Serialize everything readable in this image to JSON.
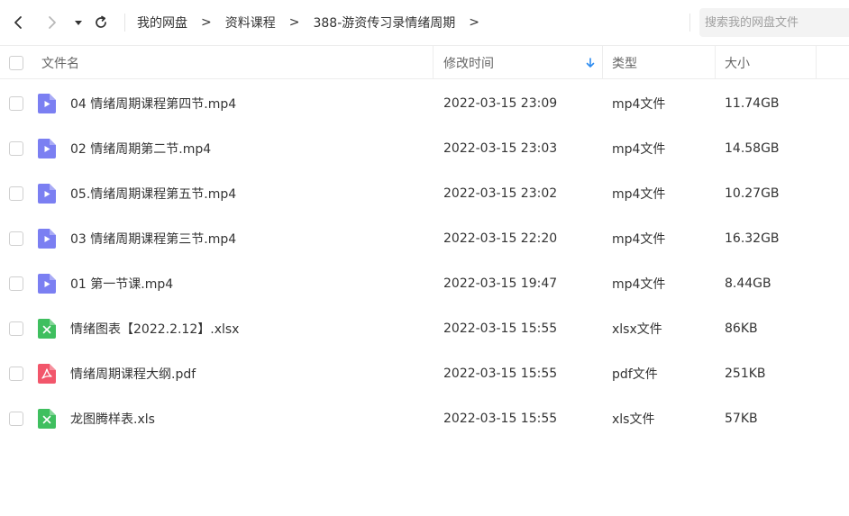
{
  "toolbar": {
    "back_icon": "chevron-left-icon",
    "forward_icon": "chevron-right-icon",
    "history_icon": "caret-down-icon",
    "refresh_icon": "refresh-icon"
  },
  "breadcrumb": {
    "items": [
      "我的网盘",
      "资料课程",
      "388-游资传习录情绪周期"
    ],
    "separator": ">"
  },
  "search": {
    "placeholder": "搜索我的网盘文件"
  },
  "table": {
    "columns": {
      "name": "文件名",
      "modified": "修改时间",
      "type": "类型",
      "size": "大小"
    },
    "sort_indicator": "sort-desc-arrow-icon",
    "rows": [
      {
        "name": "04 情绪周期课程第四节.mp4",
        "modified": "2022-03-15 23:09",
        "type": "mp4文件",
        "size": "11.74GB",
        "icon": "video-file-icon"
      },
      {
        "name": "02 情绪周期第二节.mp4",
        "modified": "2022-03-15 23:03",
        "type": "mp4文件",
        "size": "14.58GB",
        "icon": "video-file-icon"
      },
      {
        "name": "05.情绪周期课程第五节.mp4",
        "modified": "2022-03-15 23:02",
        "type": "mp4文件",
        "size": "10.27GB",
        "icon": "video-file-icon"
      },
      {
        "name": "03 情绪周期课程第三节.mp4",
        "modified": "2022-03-15 22:20",
        "type": "mp4文件",
        "size": "16.32GB",
        "icon": "video-file-icon"
      },
      {
        "name": "01 第一节课.mp4",
        "modified": "2022-03-15 19:47",
        "type": "mp4文件",
        "size": "8.44GB",
        "icon": "video-file-icon"
      },
      {
        "name": "情绪图表【2022.2.12】.xlsx",
        "modified": "2022-03-15 15:55",
        "type": "xlsx文件",
        "size": "86KB",
        "icon": "excel-file-icon"
      },
      {
        "name": "情绪周期课程大纲.pdf",
        "modified": "2022-03-15 15:55",
        "type": "pdf文件",
        "size": "251KB",
        "icon": "pdf-file-icon"
      },
      {
        "name": "龙图腾样表.xls",
        "modified": "2022-03-15 15:55",
        "type": "xls文件",
        "size": "57KB",
        "icon": "excel-file-icon"
      }
    ]
  },
  "colors": {
    "video_icon": "#7b7ff2",
    "excel_icon": "#3fbf5f",
    "pdf_icon": "#f2566b",
    "sort_arrow": "#2d8cf0"
  }
}
